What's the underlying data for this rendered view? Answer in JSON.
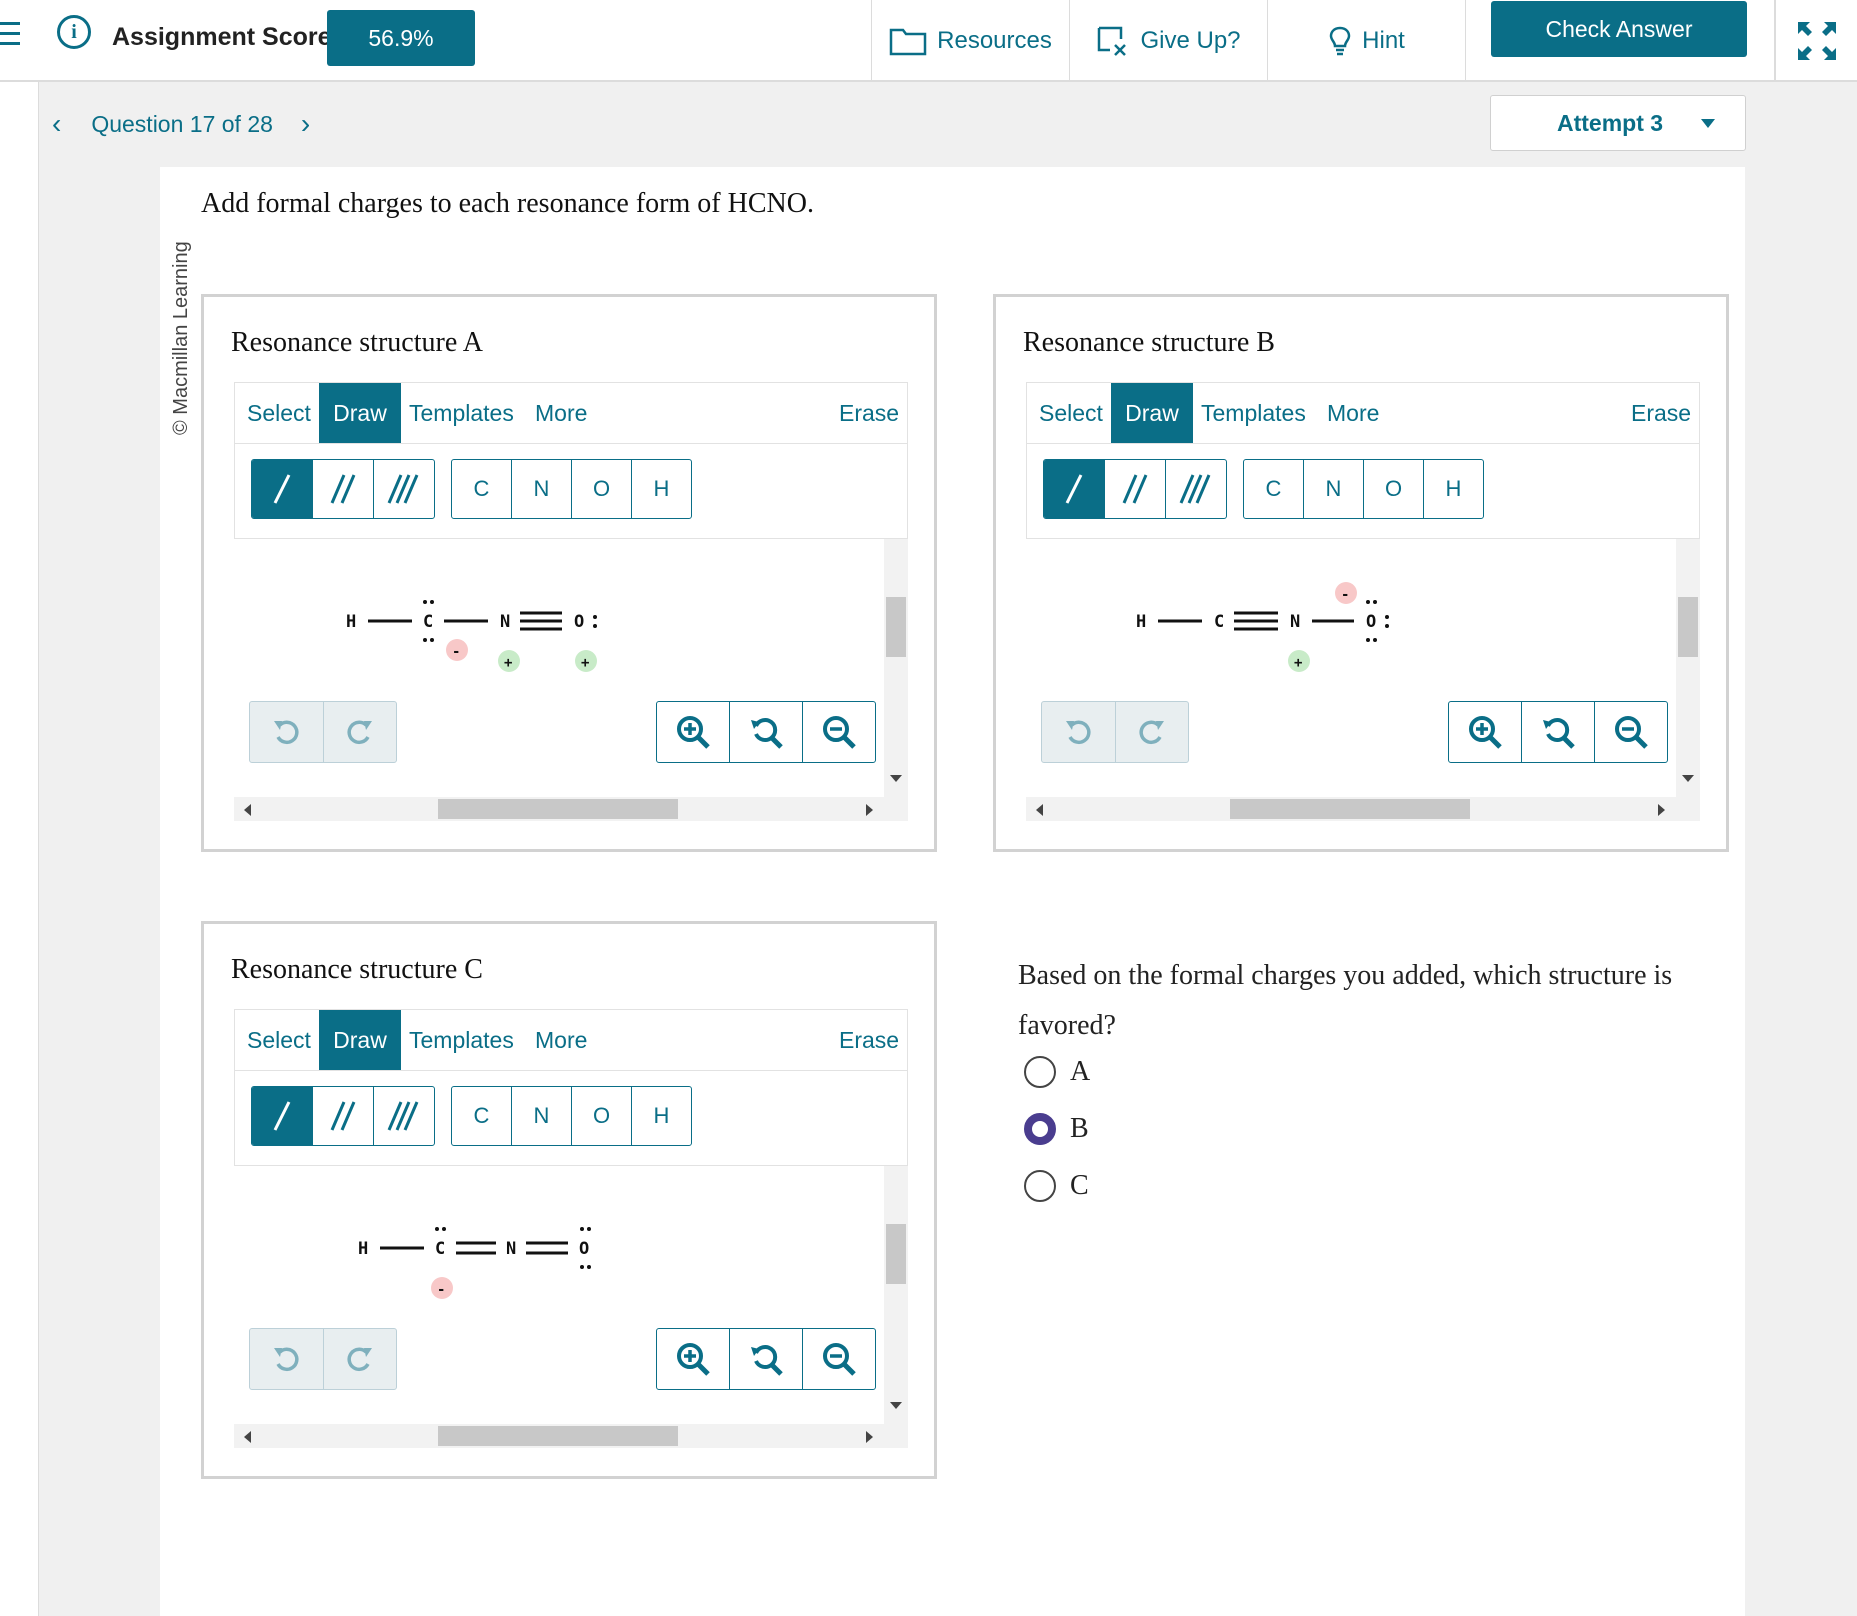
{
  "header": {
    "score_label": "Assignment Score:",
    "score_value": "56.9%",
    "resources": "Resources",
    "give_up": "Give Up?",
    "hint": "Hint",
    "check_answer": "Check Answer"
  },
  "nav": {
    "question": "Question 17 of 28",
    "attempt": "Attempt 3"
  },
  "copyright": "© Macmillan Learning",
  "question": "Add formal charges to each resonance form of HCNO.",
  "editor": {
    "tabs": [
      "Select",
      "Draw",
      "Templates",
      "More"
    ],
    "erase": "Erase",
    "atoms": [
      "C",
      "N",
      "O",
      "H"
    ]
  },
  "structures": {
    "a": {
      "title": "Resonance structure A"
    },
    "b": {
      "title": "Resonance structure B"
    },
    "c": {
      "title": "Resonance structure C"
    }
  },
  "favored": {
    "prompt": "Based on the formal charges you added, which structure is favored?",
    "options": [
      "A",
      "B",
      "C"
    ],
    "selected": "B"
  },
  "colors": {
    "accent": "#0a6e87",
    "radio_selected": "#4a3d8f",
    "negative_charge": "#f8c8c8",
    "positive_charge": "#c8ebc8"
  }
}
